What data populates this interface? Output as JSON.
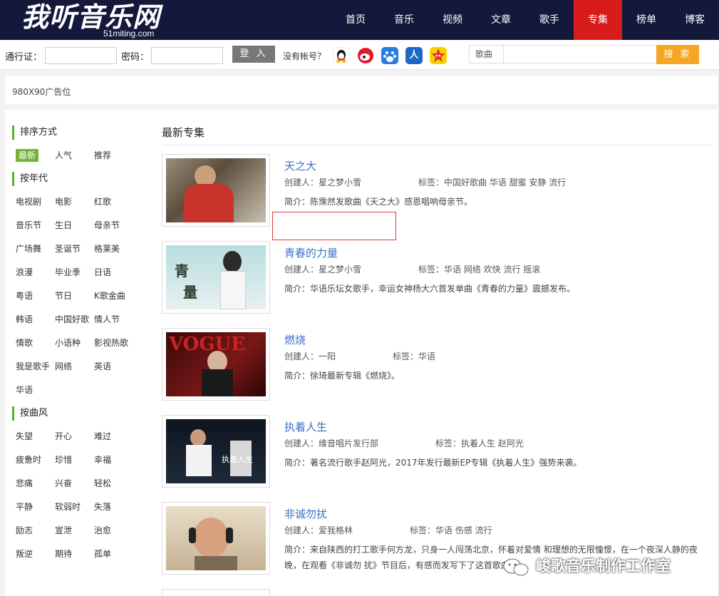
{
  "header": {
    "logo_text": "我听音乐网",
    "logo_sub": "51miting.com",
    "nav": [
      "首页",
      "音乐",
      "视频",
      "文章",
      "歌手",
      "专集",
      "榜单",
      "博客"
    ],
    "active_nav": "专集",
    "accent_color": "#d81c1c"
  },
  "login": {
    "account_label": "通行证：",
    "password_label": "密码：",
    "login_button": "登 入",
    "no_account": "没有帐号？",
    "social_icons": [
      "qq-icon",
      "weibo-icon",
      "baidu-icon",
      "renren-icon",
      "kaixin-icon"
    ],
    "search_select": "歌曲",
    "search_button": "搜 索"
  },
  "ad": {
    "text": "980X90广告位"
  },
  "sidebar": {
    "sort_title": "排序方式",
    "sort_items": [
      "最新",
      "人气",
      "推荐"
    ],
    "year_title": "按年代",
    "year_items": [
      "电视剧",
      "电影",
      "红歌",
      "音乐节",
      "生日",
      "母亲节",
      "广场舞",
      "圣诞节",
      "格莱美",
      "浪漫",
      "毕业季",
      "日语",
      "粤语",
      "节日",
      "K歌金曲",
      "韩语",
      "中国好歌",
      "情人节",
      "情歌",
      "小语种",
      "影视热歌",
      "我是歌手",
      "网络",
      "英语",
      "华语"
    ],
    "style_title": "按曲风",
    "style_items": [
      "失望",
      "开心",
      "难过",
      "疲惫时",
      "珍惜",
      "幸福",
      "悲痛",
      "兴奋",
      "轻松",
      "平静",
      "软弱时",
      "失落",
      "励志",
      "宣泄",
      "治愈",
      "叛逆",
      "期待",
      "孤单"
    ]
  },
  "content": {
    "title": "最新专集",
    "albums": [
      {
        "title": "天之大",
        "creator": "创建人：星之梦小雪",
        "tags": "标签：中国好歌曲 华语 甜蜜 安静 流行",
        "intro": "简介：陈霈然发歌曲《天之大》感恩唱响母亲节。"
      },
      {
        "title": "青春的力量",
        "creator": "创建人：星之梦小雪",
        "tags": "标签：华语 网络 欢快 流行 摇滚",
        "intro": "简介：华语乐坛女歌手，幸运女神杨大六首发单曲《青春的力量》震撼发布。"
      },
      {
        "title": "燃烧",
        "creator": "创建人：一阳",
        "tags": "标签：华语",
        "intro": "简介：徐琦最新专辑《燃烧》。"
      },
      {
        "title": "执着人生",
        "creator": "创建人：维音唱片发行部",
        "tags": "标签：执着人生 赵阿光",
        "intro": "简介：著名流行歌手赵阿光，2017年发行最新EP专辑《执着人生》强势来袭。"
      },
      {
        "title": "非诚勿扰",
        "creator": "创建人：爱我格林",
        "tags": "标签：华语 伤感 流行",
        "intro": "简介：来自陕西的打工歌手何方龙，只身一人闯荡北京，怀着对爱情 和理想的无限憧憬，在一个夜深人静的夜晚，在观看《非诚勿 扰》节目后，有感而发写下了这首歌曲……"
      }
    ]
  },
  "watermark": "峻歌音乐制作工作室"
}
